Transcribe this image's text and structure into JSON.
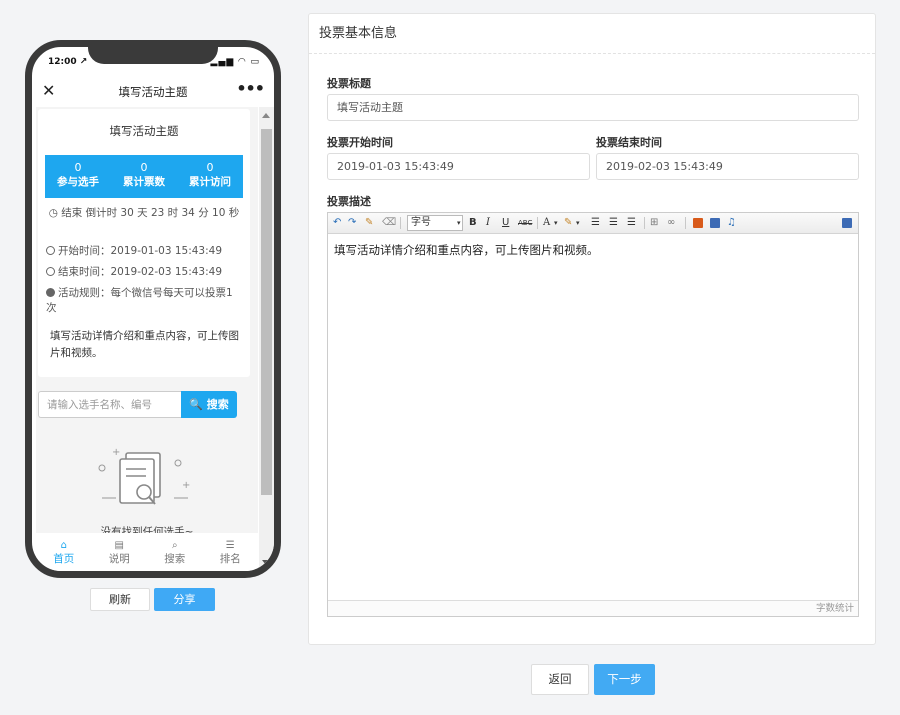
{
  "phone": {
    "status_time": "12:00 ↗",
    "status_right": "▂▄▆ ◠ ▭",
    "nav_title": "填写活动主题",
    "nav_close": "✕",
    "nav_more": "•••",
    "activity_title": "填写活动主题",
    "stats": [
      {
        "value": "0",
        "label": "参与选手"
      },
      {
        "value": "0",
        "label": "累计票数"
      },
      {
        "value": "0",
        "label": "累计访问"
      }
    ],
    "countdown": "◷ 结束 倒计时 30 天 23 时 34 分 10 秒",
    "start_time": "开始时间：2019-01-03 15:43:49",
    "end_time": "结束时间：2019-02-03 15:43:49",
    "rules": "活动规则：每个微信号每天可以投票1次",
    "desc": "填写活动详情介绍和重点内容，可上传图片和视频。",
    "search_placeholder": "请输入选手名称、编号",
    "search_button": "🔍 搜索",
    "empty_text": "没有找到任何选手~",
    "tabs": [
      {
        "icon": "home-icon",
        "glyph": "⌂",
        "label": "首页",
        "active": true
      },
      {
        "icon": "document-icon",
        "glyph": "▤",
        "label": "说明",
        "active": false
      },
      {
        "icon": "search-icon",
        "glyph": "⌕",
        "label": "搜索",
        "active": false
      },
      {
        "icon": "list-icon",
        "glyph": "☰",
        "label": "排名",
        "active": false
      }
    ],
    "refresh_button": "刷新",
    "share_button": "分享"
  },
  "form": {
    "panel_title": "投票基本信息",
    "title_label": "投票标题",
    "title_value": "填写活动主题",
    "start_label": "投票开始时间",
    "start_value": "2019-01-03 15:43:49",
    "end_label": "投票结束时间",
    "end_value": "2019-02-03 15:43:49",
    "desc_label": "投票描述",
    "editor": {
      "font_size_label": "字号",
      "bold": "B",
      "italic": "I",
      "underline": "U",
      "strike": "ABC",
      "font_color": "A",
      "content": "填写活动详情介绍和重点内容，可上传图片和视频。",
      "word_count": "字数统计"
    },
    "back_button": "返回",
    "next_button": "下一步"
  },
  "colors": {
    "accent": "#1ea7ef",
    "button_blue": "#42aaf3",
    "phone_frame": "#3a3a3a"
  }
}
